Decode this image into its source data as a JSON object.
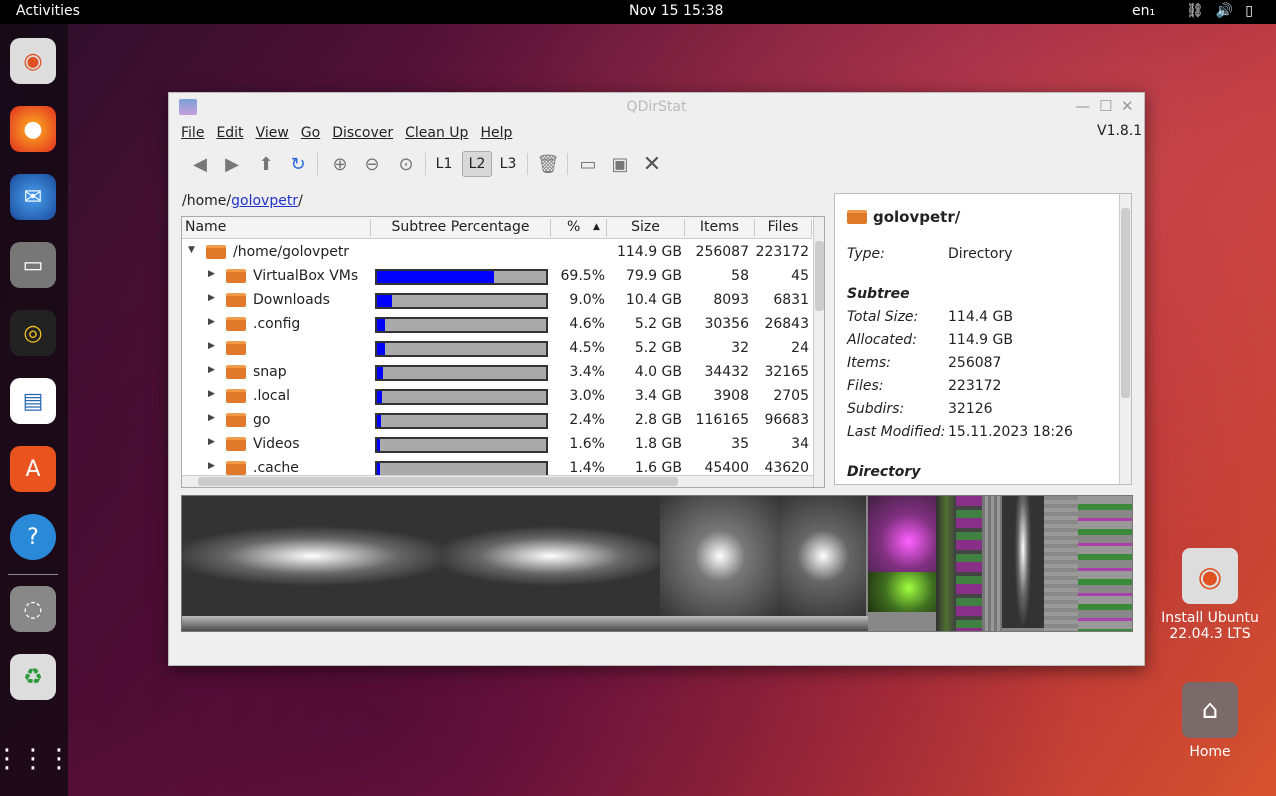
{
  "topbar": {
    "activities": "Activities",
    "clock": "Nov 15  15:38",
    "lang": "en₁"
  },
  "desktop": {
    "install_label": "Install Ubuntu 22.04.3 LTS",
    "home_label": "Home"
  },
  "window": {
    "title": "QDirStat",
    "version": "V1.8.1",
    "menu": [
      "File",
      "Edit",
      "View",
      "Go",
      "Discover",
      "Clean Up",
      "Help"
    ],
    "levels": [
      "L1",
      "L2",
      "L3"
    ],
    "path_prefix": "/home/",
    "path_link": "golovpetr",
    "path_suffix": "/",
    "columns": [
      "Name",
      "Subtree Percentage",
      "%",
      "Size",
      "Items",
      "Files"
    ],
    "root": {
      "name": "/home/golovpetr",
      "size": "114.9 GB",
      "items": "256087",
      "files": "223172"
    },
    "rows": [
      {
        "name": "VirtualBox VMs",
        "pct": "69.5%",
        "pctv": 69.5,
        "size": "79.9 GB",
        "items": "58",
        "files": "45"
      },
      {
        "name": "Downloads",
        "pct": "9.0%",
        "pctv": 9.0,
        "size": "10.4 GB",
        "items": "8093",
        "files": "6831"
      },
      {
        "name": ".config",
        "pct": "4.6%",
        "pctv": 4.6,
        "size": "5.2 GB",
        "items": "30356",
        "files": "26843"
      },
      {
        "name": "",
        "pct": "4.5%",
        "pctv": 4.5,
        "size": "5.2 GB",
        "items": "32",
        "files": "24"
      },
      {
        "name": "snap",
        "pct": "3.4%",
        "pctv": 3.4,
        "size": "4.0 GB",
        "items": "34432",
        "files": "32165"
      },
      {
        "name": ".local",
        "pct": "3.0%",
        "pctv": 3.0,
        "size": "3.4 GB",
        "items": "3908",
        "files": "2705"
      },
      {
        "name": "go",
        "pct": "2.4%",
        "pctv": 2.4,
        "size": "2.8 GB",
        "items": "116165",
        "files": "96683"
      },
      {
        "name": "Videos",
        "pct": "1.6%",
        "pctv": 1.6,
        "size": "1.8 GB",
        "items": "35",
        "files": "34"
      },
      {
        "name": ".cache",
        "pct": "1.4%",
        "pctv": 1.4,
        "size": "1.6 GB",
        "items": "45400",
        "files": "43620"
      }
    ],
    "details": {
      "heading": "golovpetr/",
      "type_k": "Type:",
      "type_v": "Directory",
      "subtree": "Subtree",
      "fields": [
        [
          "Total Size:",
          "114.4 GB"
        ],
        [
          "Allocated:",
          "114.9 GB"
        ],
        [
          "Items:",
          "256087"
        ],
        [
          "Files:",
          "223172"
        ],
        [
          "Subdirs:",
          "32126"
        ],
        [
          "Last Modified:",
          "15.11.2023 18:26"
        ]
      ],
      "footer": "Directory"
    }
  },
  "colors": {
    "bar_fill": "#0000ff",
    "folder": "#e07a2a"
  }
}
